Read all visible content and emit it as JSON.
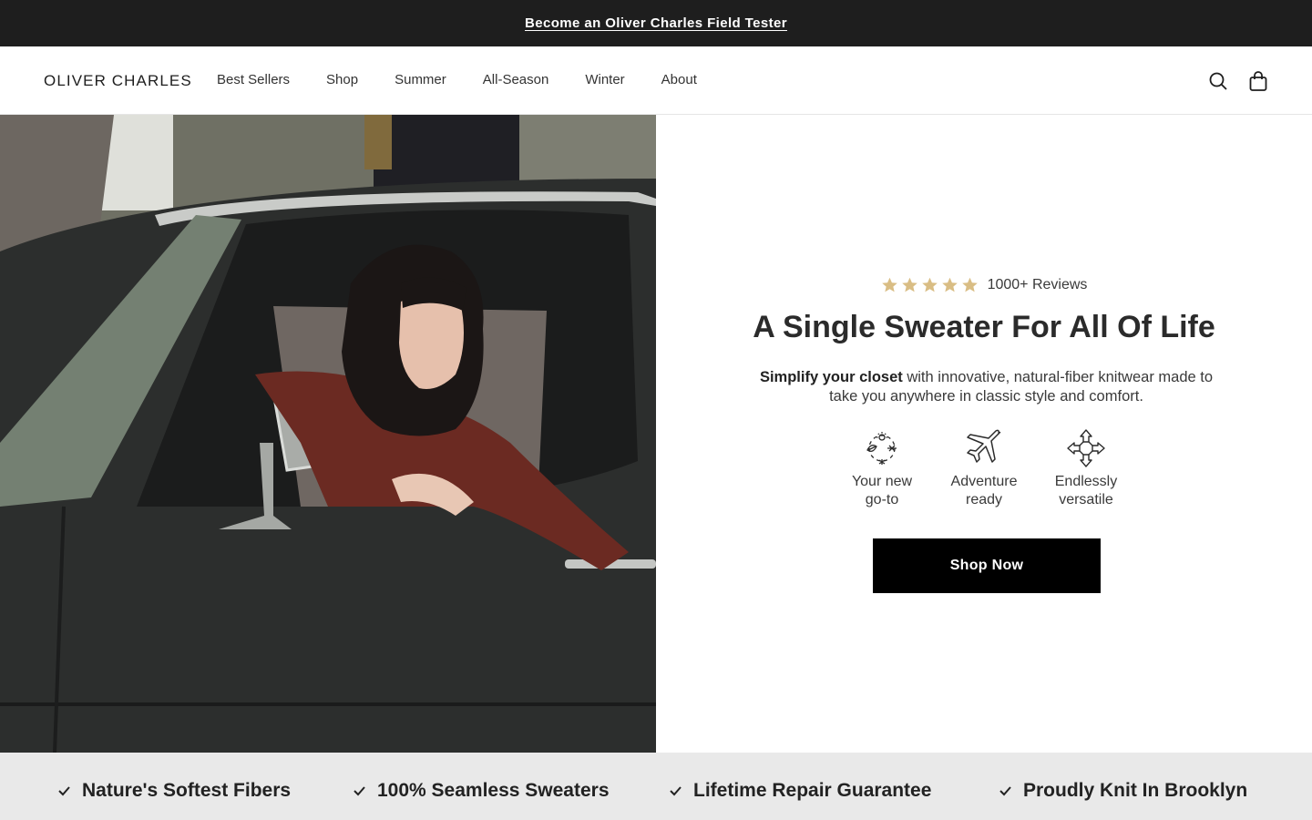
{
  "announcement": {
    "text": "Become an Oliver Charles Field Tester"
  },
  "header": {
    "logo": "OLIVER CHARLES",
    "nav": [
      "Best Sellers",
      "Shop",
      "Summer",
      "All-Season",
      "Winter",
      "About"
    ],
    "icons": [
      "search-icon",
      "bag-icon"
    ]
  },
  "hero": {
    "image_alt": "Woman in a rust-red sweater looking out the window of a black vintage pickup truck",
    "rating": {
      "stars": 5,
      "text": "1000+ Reviews"
    },
    "headline": "A Single Sweater For All Of Life",
    "subcopy_bold": "Simplify your closet",
    "subcopy_rest": " with innovative, natural-fiber knitwear made to take you anywhere in classic style and comfort.",
    "features": [
      {
        "icon": "seasons-icon",
        "line1": "Your new",
        "line2": "go-to"
      },
      {
        "icon": "airplane-icon",
        "line1": "Adventure",
        "line2": "ready"
      },
      {
        "icon": "arrows-out-icon",
        "line1": "Endlessly",
        "line2": "versatile"
      }
    ],
    "cta": "Shop Now"
  },
  "usps": [
    "Nature's Softest Fibers",
    "100% Seamless Sweaters",
    "Lifetime Repair Guarantee",
    "Proudly Knit In Brooklyn"
  ],
  "colors": {
    "announcement_bg": "#1e1e1e",
    "star": "#d9bd84",
    "cta_bg": "#000000",
    "usp_bg": "#e9e9e9"
  }
}
